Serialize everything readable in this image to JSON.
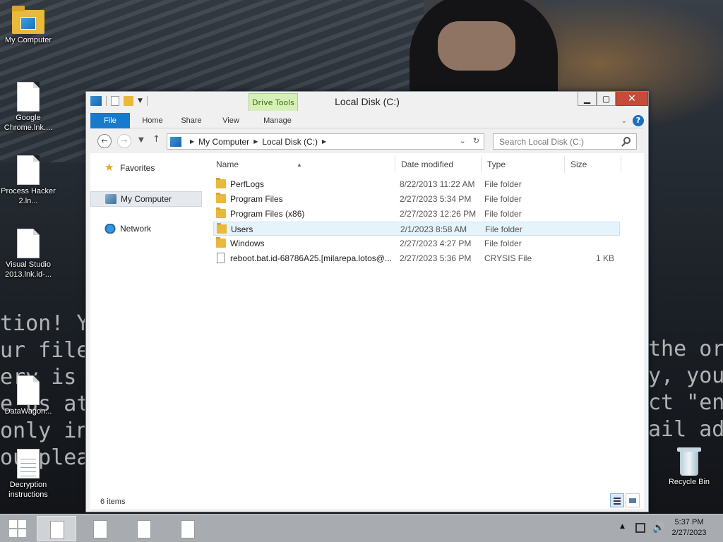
{
  "desktop": {
    "icons": [
      {
        "label": "My Computer",
        "icon": "folder-computer-icon"
      },
      {
        "label": "Google Chrome.lnk....",
        "icon": "document-icon"
      },
      {
        "label": "Process Hacker 2.ln...",
        "icon": "document-icon"
      },
      {
        "label": "Visual Studio 2013.lnk.id-...",
        "icon": "document-icon"
      },
      {
        "label": "DataWagon...",
        "icon": "document-icon"
      },
      {
        "label": "Decryption instructions",
        "icon": "text-document-icon"
      },
      {
        "label": "Recycle Bin",
        "icon": "recycle-bin-icon"
      }
    ],
    "wallpaper_text_left": [
      "tion! Yo",
      "ur files",
      "ery is in",
      "e us at t",
      "only in c",
      "ou plea"
    ],
    "wallpaper_text_right": [
      "the ori",
      "y, you",
      "ct \"enc",
      "ail add"
    ]
  },
  "window": {
    "title": "Local Disk (C:)",
    "minimize": "▁",
    "maximize": "▢",
    "close": "✕",
    "ribbon": {
      "context_group": "Drive Tools",
      "tabs": [
        "File",
        "Home",
        "Share",
        "View",
        "Manage"
      ],
      "expand_chevron": "⌄",
      "help": "?"
    },
    "address": {
      "crumbs": [
        "My Computer",
        "Local Disk (C:)"
      ],
      "search_placeholder": "Search Local Disk (C:)"
    },
    "nav_pane": {
      "items": [
        {
          "label": "Favorites",
          "icon": "star-icon"
        },
        {
          "label": "My Computer",
          "icon": "computer-icon"
        },
        {
          "label": "Network",
          "icon": "network-icon"
        }
      ]
    },
    "columns": [
      "Name",
      "Date modified",
      "Type",
      "Size"
    ],
    "files": [
      {
        "name": "PerfLogs",
        "date": "8/22/2013 11:22 AM",
        "type": "File folder",
        "size": "",
        "icon": "folder-icon"
      },
      {
        "name": "Program Files",
        "date": "2/27/2023 5:34 PM",
        "type": "File folder",
        "size": "",
        "icon": "folder-icon"
      },
      {
        "name": "Program Files (x86)",
        "date": "2/27/2023 12:26 PM",
        "type": "File folder",
        "size": "",
        "icon": "folder-icon"
      },
      {
        "name": "Users",
        "date": "2/1/2023 8:58 AM",
        "type": "File folder",
        "size": "",
        "icon": "folder-icon"
      },
      {
        "name": "Windows",
        "date": "2/27/2023 4:27 PM",
        "type": "File folder",
        "size": "",
        "icon": "folder-icon"
      },
      {
        "name": "reboot.bat.id-68786A25.[milarepa.lotos@...",
        "date": "2/27/2023 5:36 PM",
        "type": "CRYSIS File",
        "size": "1 KB",
        "icon": "file-icon"
      }
    ],
    "status": "6 items"
  },
  "taskbar": {
    "time": "5:37 PM",
    "date": "2/27/2023",
    "tray_arrow": "▲",
    "volume": "🔊"
  }
}
